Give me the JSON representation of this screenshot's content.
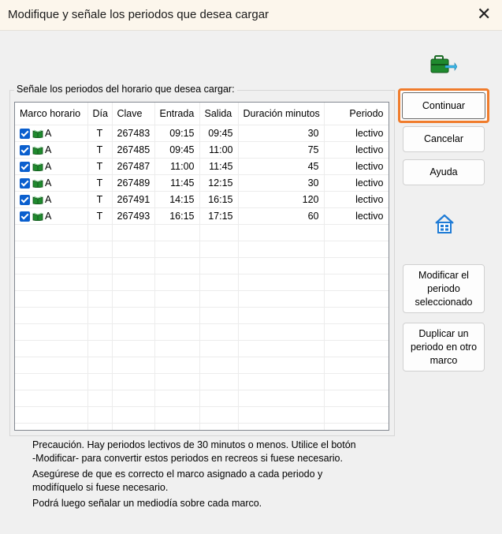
{
  "window": {
    "title": "Modifique y señale los periodos que desea cargar",
    "close_glyph": "✕"
  },
  "group_label": "Señale los periodos del horario que desea cargar:",
  "columns": [
    "Marco horario",
    "Día",
    "Clave",
    "Entrada",
    "Salida",
    "Duración minutos",
    "Periodo"
  ],
  "rows": [
    {
      "marco": "A",
      "dia": "T",
      "clave": "267483",
      "entrada": "09:15",
      "salida": "09:45",
      "duracion": "30",
      "periodo": "lectivo"
    },
    {
      "marco": "A",
      "dia": "T",
      "clave": "267485",
      "entrada": "09:45",
      "salida": "11:00",
      "duracion": "75",
      "periodo": "lectivo"
    },
    {
      "marco": "A",
      "dia": "T",
      "clave": "267487",
      "entrada": "11:00",
      "salida": "11:45",
      "duracion": "45",
      "periodo": "lectivo"
    },
    {
      "marco": "A",
      "dia": "T",
      "clave": "267489",
      "entrada": "11:45",
      "salida": "12:15",
      "duracion": "30",
      "periodo": "lectivo"
    },
    {
      "marco": "A",
      "dia": "T",
      "clave": "267491",
      "entrada": "14:15",
      "salida": "16:15",
      "duracion": "120",
      "periodo": "lectivo"
    },
    {
      "marco": "A",
      "dia": "T",
      "clave": "267493",
      "entrada": "16:15",
      "salida": "17:15",
      "duracion": "60",
      "periodo": "lectivo"
    }
  ],
  "buttons": {
    "continuar": "Continuar",
    "cancelar": "Cancelar",
    "ayuda": "Ayuda",
    "modificar": [
      "Modificar el",
      "periodo",
      "seleccionado"
    ],
    "duplicar": [
      "Duplicar un",
      "periodo en otro",
      "marco"
    ]
  },
  "notes": [
    [
      "Precaución. Hay periodos lectivos de 30 minutos o menos. Utilice el botón",
      "-Modificar- para convertir estos periodos en recreos si fuese necesario."
    ],
    [
      "Asegúrese de que es correcto el marco asignado a cada periodo y",
      "modifíquelo si fuese necesario."
    ],
    [
      "Podrá luego señalar un mediodía sobre cada marco."
    ]
  ],
  "colors": {
    "accent": "#0a5fce",
    "focus": "#f07c2c",
    "briefcase": "#1f8a2e",
    "home": "#1e7bd6"
  },
  "icons": {
    "briefcase": "briefcase-icon",
    "home": "home-icon",
    "book": "book-icon",
    "checkbox": "checkbox-icon"
  }
}
